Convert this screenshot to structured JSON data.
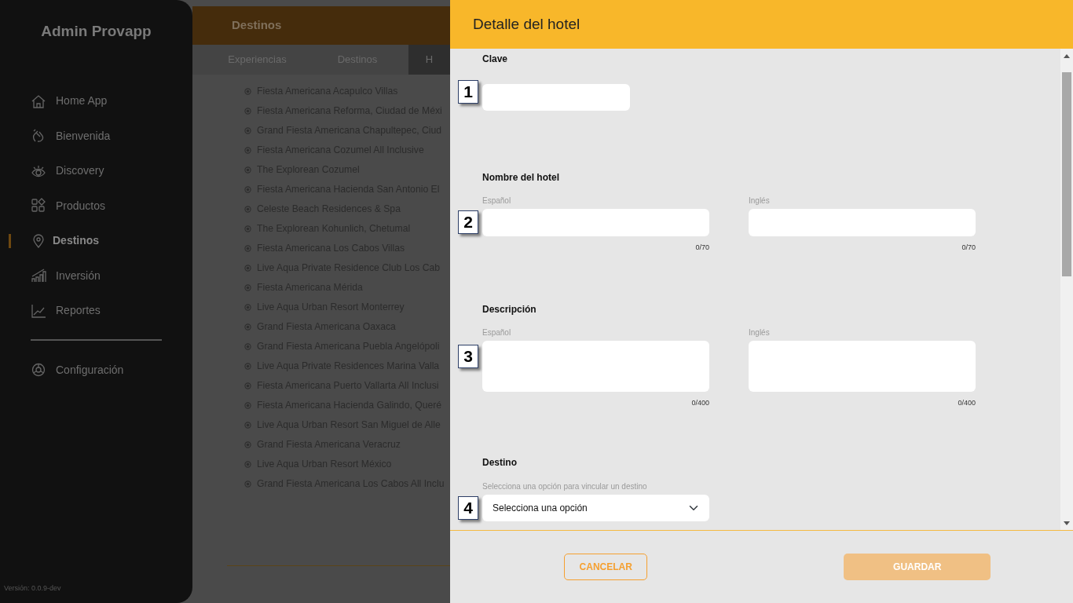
{
  "sidebar": {
    "title": "Admin Provapp",
    "items": [
      {
        "label": "Home App",
        "selected": false
      },
      {
        "label": "Bienvenida",
        "selected": false
      },
      {
        "label": "Discovery",
        "selected": false
      },
      {
        "label": "Productos",
        "selected": false
      },
      {
        "label": "Destinos",
        "selected": true
      },
      {
        "label": "Inversión",
        "selected": false
      },
      {
        "label": "Reportes",
        "selected": false
      }
    ],
    "settings": {
      "label": "Configuración",
      "selected": false
    },
    "version": "Versión: 0.0.9-dev"
  },
  "header": {
    "title": "Destinos"
  },
  "tabs": [
    {
      "label": "Experiencias",
      "selected": false
    },
    {
      "label": "Destinos",
      "selected": false
    },
    {
      "label": "H",
      "selected": true
    }
  ],
  "hotels": [
    "Fiesta Americana Acapulco Villas",
    "Fiesta Americana Reforma, Ciudad de Méxi",
    "Grand Fiesta Americana Chapultepec, Ciud",
    "Fiesta Americana Cozumel All Inclusive",
    "The Explorean Cozumel",
    "Fiesta Americana Hacienda San Antonio El",
    "Celeste Beach Residences & Spa",
    "The Explorean Kohunlich, Chetumal",
    "Fiesta Americana Los Cabos Villas",
    "Live Aqua Private Residence Club Los Cab",
    "Fiesta Americana Mérida",
    "Live Aqua Urban Resort Monterrey",
    "Grand Fiesta Americana Oaxaca",
    "Grand Fiesta Americana Puebla Angelópoli",
    "Live Aqua Private Residences Marina Valla",
    "Fiesta Americana Puerto Vallarta All Inclusi",
    "Fiesta Americana Hacienda Galindo, Queré",
    "Live Aqua Urban Resort San Miguel de Alle",
    "Grand Fiesta Americana Veracruz",
    "Live Aqua Urban Resort México",
    "Grand Fiesta Americana Los Cabos All Inclu"
  ],
  "drawer": {
    "title": "Detalle del hotel",
    "sections": [
      {
        "kind": "single",
        "label": "Clave",
        "marker": "1"
      },
      {
        "kind": "pair",
        "label": "Nombre del hotel",
        "marker": "2",
        "fields": [
          {
            "sublabel": "Español",
            "counter": "0/70"
          },
          {
            "sublabel": "Inglés",
            "counter": "0/70"
          }
        ]
      },
      {
        "kind": "textareas",
        "label": "Descripción",
        "marker": "3",
        "fields": [
          {
            "sublabel": "Español",
            "counter": "0/400"
          },
          {
            "sublabel": "Inglés",
            "counter": "0/400"
          }
        ]
      },
      {
        "kind": "select",
        "label": "Destino",
        "hint": "Selecciona una opción para vincular un destino",
        "value": "Selecciona una opción",
        "marker": "4"
      }
    ],
    "buttons": [
      {
        "label": "CANCELAR",
        "kind": "outline",
        "disabled": false
      },
      {
        "label": "GUARDAR",
        "kind": "filled",
        "disabled": true
      }
    ]
  }
}
